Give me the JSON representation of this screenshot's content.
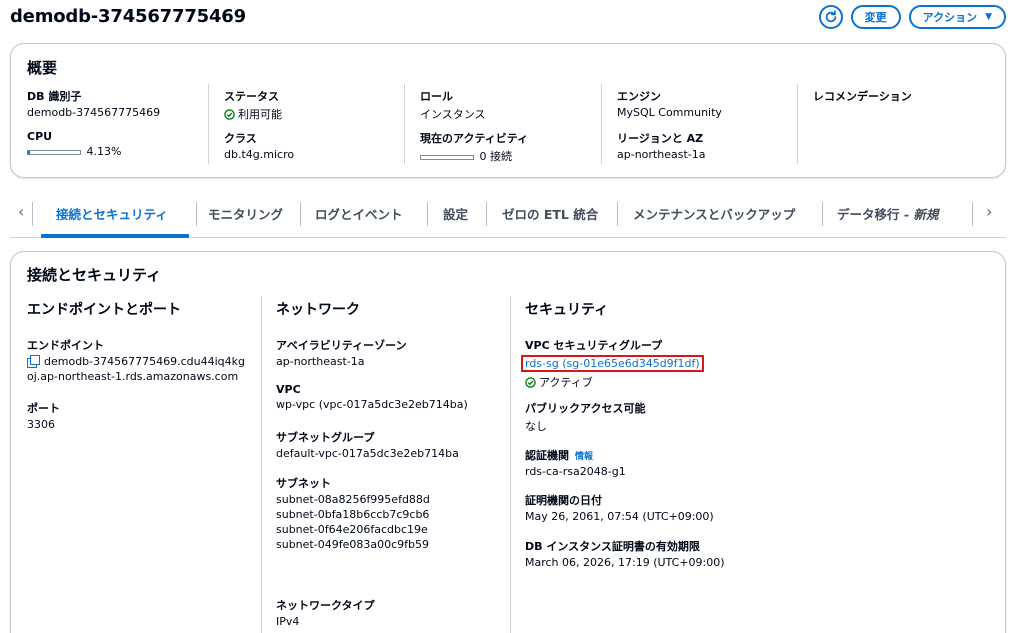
{
  "header": {
    "title": "demodb-374567775469",
    "modify_label": "変更",
    "actions_label": "アクション"
  },
  "summary": {
    "title": "概要",
    "db_id_label": "DB 識別子",
    "db_id_value": "demodb-374567775469",
    "cpu_label": "CPU",
    "cpu_value": "4.13%",
    "cpu_fraction": 0.0413,
    "status_label": "ステータス",
    "status_value": "利用可能",
    "class_label": "クラス",
    "class_value": "db.t4g.micro",
    "role_label": "ロール",
    "role_value": "インスタンス",
    "activity_label": "現在のアクティビティ",
    "activity_value": "0 接続",
    "activity_fraction": 0,
    "engine_label": "エンジン",
    "engine_value": "MySQL Community",
    "region_label": "リージョンと AZ",
    "region_value": "ap-northeast-1a",
    "recommendation_label": "レコメンデーション"
  },
  "tabs": [
    {
      "label": "接続とセキュリティ"
    },
    {
      "label": "モニタリング"
    },
    {
      "label": "ログとイベント"
    },
    {
      "label": "設定"
    },
    {
      "label": "ゼロの ETL 統合"
    },
    {
      "label": "メンテナンスとバックアップ"
    },
    {
      "label": "データ移行 - ",
      "suffix": "新規"
    }
  ],
  "connectivity": {
    "title": "接続とセキュリティ",
    "endpoint_section": "エンドポイントとポート",
    "endpoint_label": "エンドポイント",
    "endpoint_line1": "demodb-374567775469.cdu44iq4kg",
    "endpoint_line2": "oj.ap-northeast-1.rds.amazonaws.com",
    "port_label": "ポート",
    "port_value": "3306",
    "network_section": "ネットワーク",
    "az_label": "アベイラビリティーゾーン",
    "az_value": "ap-northeast-1a",
    "vpc_label": "VPC",
    "vpc_value": "wp-vpc (vpc-017a5dc3e2eb714ba)",
    "subnet_group_label": "サブネットグループ",
    "subnet_group_value": "default-vpc-017a5dc3e2eb714ba",
    "subnets_label": "サブネット",
    "subnets": [
      "subnet-08a8256f995efd88d",
      "subnet-0bfa18b6ccb7c9cb6",
      "subnet-0f64e206facdbc19e",
      "subnet-049fe083a00c9fb59"
    ],
    "network_type_label": "ネットワークタイプ",
    "network_type_value": "IPv4",
    "security_section": "セキュリティ",
    "sg_label": "VPC セキュリティグループ",
    "sg_value": "rds-sg (sg-01e65e6d345d9f1df)",
    "sg_status": "アクティブ",
    "public_label": "パブリックアクセス可能",
    "public_value": "なし",
    "ca_label": "認証機関",
    "ca_info": "情報",
    "ca_value": "rds-ca-rsa2048-g1",
    "ca_date_label": "証明機関の日付",
    "ca_date_value": "May 26, 2061, 07:54 (UTC+09:00)",
    "cert_expiry_label": "DB インスタンス証明書の有効期限",
    "cert_expiry_value": "March 06, 2026, 17:19 (UTC+09:00)"
  }
}
